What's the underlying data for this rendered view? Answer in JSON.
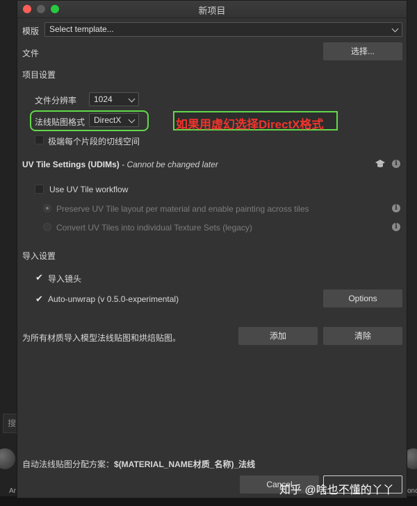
{
  "window": {
    "title": "新项目"
  },
  "template": {
    "label": "模版",
    "value": "Select template..."
  },
  "file": {
    "label": "文件",
    "select_button": "选择..."
  },
  "project_settings": {
    "heading": "项目设置",
    "resolution_label": "文件分辨率",
    "resolution_value": "1024",
    "normal_format_label": "法线贴图格式",
    "normal_format_value": "DirectX",
    "tangent_label": "极端每个片段的切线空间"
  },
  "annotation": {
    "text": "如果用虚幻选择DirectX格式"
  },
  "uv_tile": {
    "heading": "UV Tile Settings (UDIMs)",
    "note": "- Cannot be changed later",
    "workflow_label": "Use UV Tile workflow",
    "option1_label": "Preserve UV Tile layout per material and enable painting across tiles",
    "option2_label": "Convert UV Tiles into individual Texture Sets (legacy)"
  },
  "import_settings": {
    "heading": "导入设置",
    "import_cameras_label": "导入镜头",
    "auto_unwrap_label": "Auto-unwrap (v 0.5.0-experimental)",
    "options_button": "Options"
  },
  "bake": {
    "label": "为所有材质导入模型法线贴图和烘焙贴图。",
    "add_button": "添加",
    "clear_button": "清除"
  },
  "naming": {
    "label": "自动法线贴图分配方案：",
    "value": "$(MATERIAL_NAME材质_名称)_法线"
  },
  "footer": {
    "cancel_button": "Cancel"
  },
  "watermark": {
    "text": "知乎 @啥也不懂的丫丫"
  },
  "background": {
    "search_glyph": "搜",
    "label_a": "Ar",
    "label_b": "onc"
  },
  "colors": {
    "accent_green": "#63d84b",
    "annotation_red": "#f0342c",
    "dialog_bg": "#333333"
  }
}
